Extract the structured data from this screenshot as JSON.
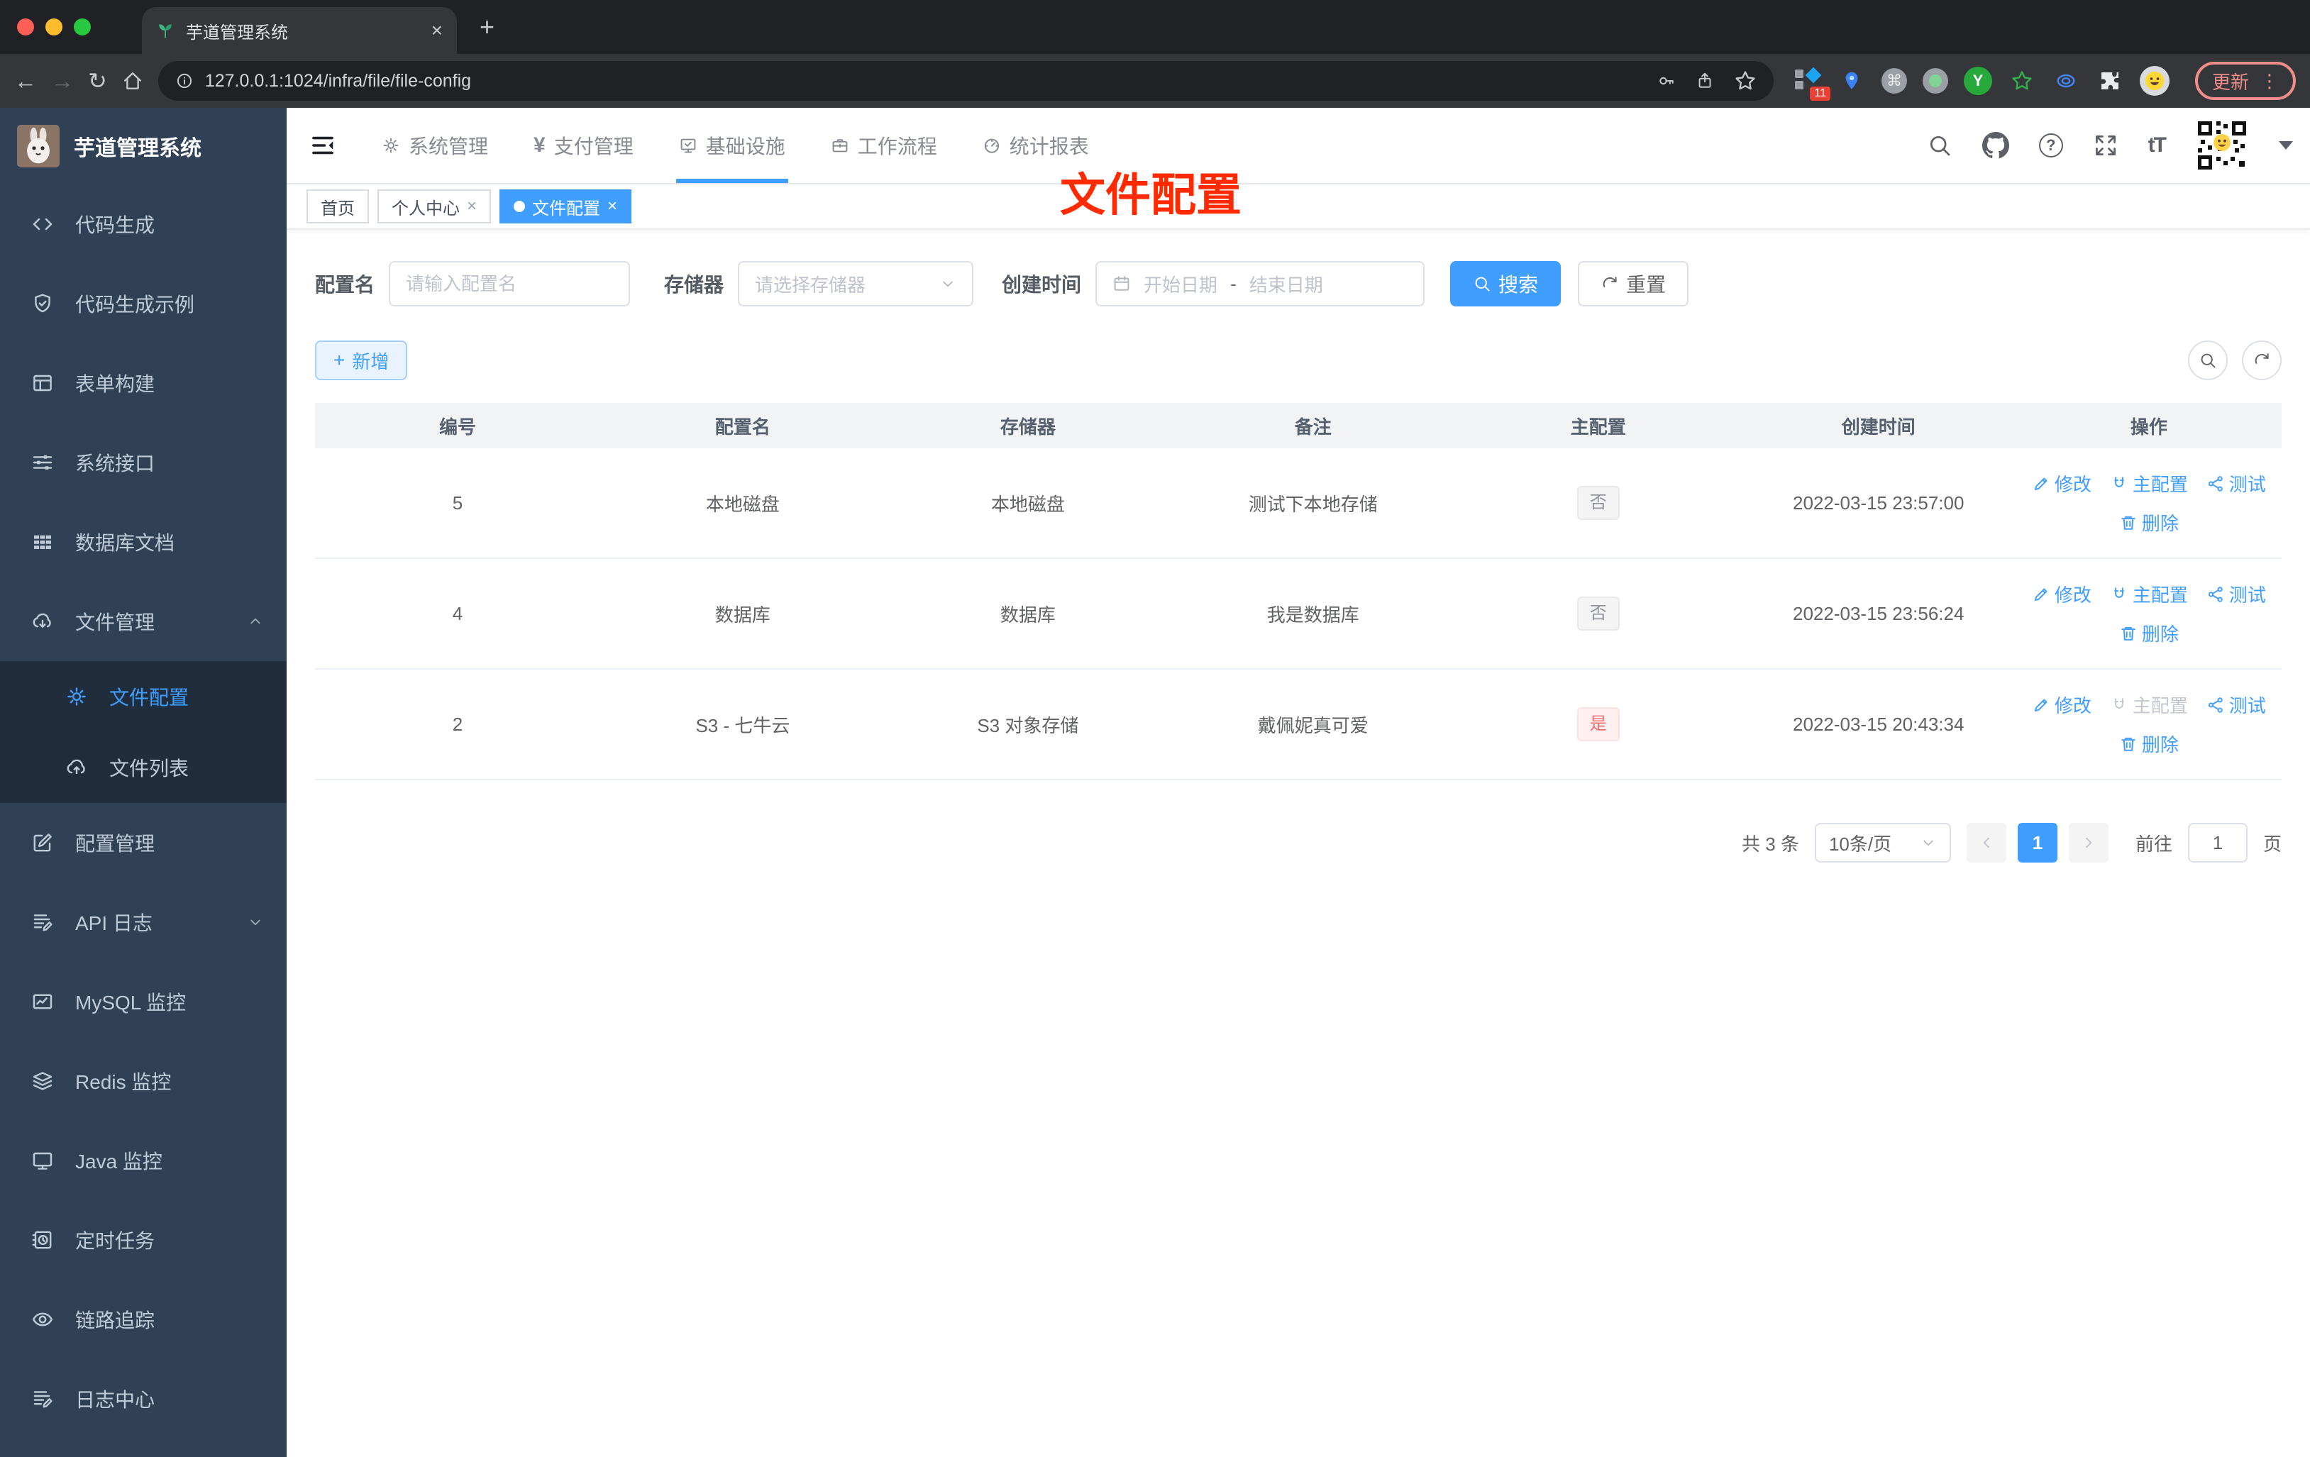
{
  "colors": {
    "accent": "#409eff",
    "danger": "#f56c6c",
    "annotation_red": "#ff2a00",
    "sidebar_bg": "#304156",
    "submenu_bg": "#1f2d3d"
  },
  "browser": {
    "tab_title": "芋道管理系统",
    "tab_close": "×",
    "new_tab": "+",
    "url": "127.0.0.1:1024/infra/file/file-config",
    "back": "←",
    "forward": "→",
    "reload": "↻",
    "ext_badge": "11",
    "ext_cmd": "⌘",
    "ext_y": "Y",
    "update_label": "更新",
    "menu_dots": "⋮"
  },
  "header": {
    "nav": [
      {
        "label": "系统管理"
      },
      {
        "label": "支付管理",
        "icon_text": "¥"
      },
      {
        "label": "基础设施"
      },
      {
        "label": "工作流程"
      },
      {
        "label": "统计报表"
      }
    ],
    "help_glyph": "?",
    "font_size_glyph": "tT"
  },
  "sidebar": {
    "logo_title": "芋道管理系统",
    "items": [
      {
        "label": "代码生成"
      },
      {
        "label": "代码生成示例"
      },
      {
        "label": "表单构建"
      },
      {
        "label": "系统接口"
      },
      {
        "label": "数据库文档"
      },
      {
        "label": "文件管理"
      },
      {
        "label": "文件配置"
      },
      {
        "label": "文件列表"
      },
      {
        "label": "配置管理"
      },
      {
        "label": "API 日志"
      },
      {
        "label": "MySQL 监控"
      },
      {
        "label": "Redis 监控"
      },
      {
        "label": "Java 监控"
      },
      {
        "label": "定时任务"
      },
      {
        "label": "链路追踪"
      },
      {
        "label": "日志中心"
      }
    ]
  },
  "tags": [
    {
      "label": "首页"
    },
    {
      "label": "个人中心",
      "close": "×"
    },
    {
      "label": "文件配置",
      "close": "×"
    }
  ],
  "annotation": "文件配置",
  "filter": {
    "config_name_label": "配置名",
    "config_name_placeholder": "请输入配置名",
    "storage_label": "存储器",
    "storage_placeholder": "请选择存储器",
    "create_time_label": "创建时间",
    "start_date_placeholder": "开始日期",
    "date_separator": "-",
    "end_date_placeholder": "结束日期",
    "search_label": "搜索",
    "reset_label": "重置"
  },
  "toolbar": {
    "add_label": "新增"
  },
  "table": {
    "columns": [
      "编号",
      "配置名",
      "存储器",
      "备注",
      "主配置",
      "创建时间",
      "操作"
    ],
    "actions": {
      "edit": "修改",
      "master": "主配置",
      "test": "测试",
      "delete": "删除"
    },
    "rows": [
      {
        "id": "5",
        "name": "本地磁盘",
        "storage": "本地磁盘",
        "remark": "测试下本地存储",
        "master": "否",
        "created": "2022-03-15 23:57:00"
      },
      {
        "id": "4",
        "name": "数据库",
        "storage": "数据库",
        "remark": "我是数据库",
        "master": "否",
        "created": "2022-03-15 23:56:24"
      },
      {
        "id": "2",
        "name": "S3 - 七牛云",
        "storage": "S3 对象存储",
        "remark": "戴佩妮真可爱",
        "master": "是",
        "created": "2022-03-15 20:43:34"
      }
    ]
  },
  "pagination": {
    "total_text": "共 3 条",
    "page_size": "10条/页",
    "current_page": "1",
    "goto_label": "前往",
    "goto_value": "1",
    "page_unit": "页"
  }
}
